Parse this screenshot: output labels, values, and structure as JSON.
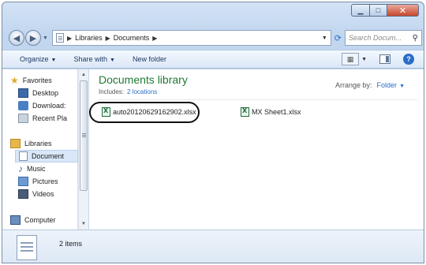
{
  "address": {
    "crumbs": [
      "Libraries",
      "Documents"
    ]
  },
  "search": {
    "placeholder": "Search Docum..."
  },
  "toolbar": {
    "organize": "Organize",
    "share_with": "Share with",
    "new_folder": "New folder"
  },
  "nav": {
    "favorites": "Favorites",
    "desktop": "Desktop",
    "downloads": "Download:",
    "recent": "Recent Pla",
    "libraries": "Libraries",
    "documents": "Document",
    "music": "Music",
    "pictures": "Pictures",
    "videos": "Videos",
    "computer": "Computer"
  },
  "content": {
    "title": "Documents library",
    "includes_label": "Includes:",
    "locations": "2 locations",
    "arrange_label": "Arrange by:",
    "arrange_value": "Folder",
    "files": [
      {
        "name": "auto20120629162902.xlsx"
      },
      {
        "name": "MX Sheet1.xlsx"
      }
    ]
  },
  "status": {
    "items": "2 items"
  }
}
